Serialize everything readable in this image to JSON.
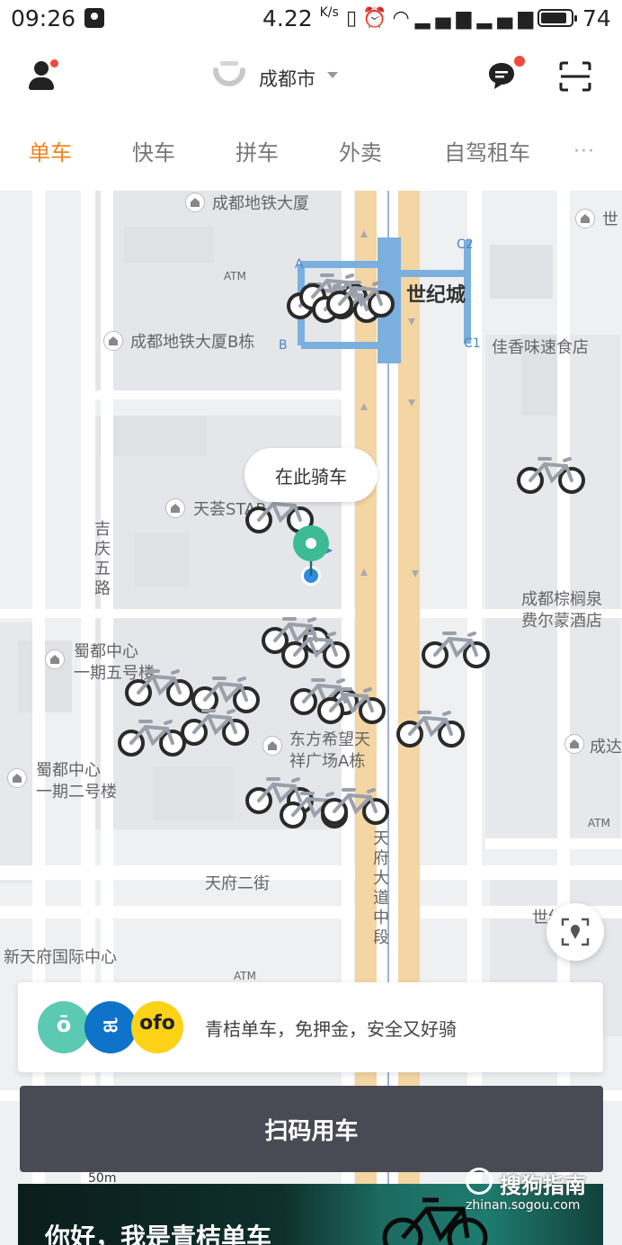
{
  "status_bar": {
    "time": "09:26",
    "speed": "4.22",
    "speed_unit": "K/s",
    "battery_level": "74",
    "network": "3G"
  },
  "header": {
    "city": "成都市",
    "has_user_notification": true,
    "has_message_notification": true
  },
  "tabs": [
    {
      "label": "单车",
      "active": true
    },
    {
      "label": "快车",
      "active": false
    },
    {
      "label": "拼车",
      "active": false
    },
    {
      "label": "外卖",
      "active": false
    },
    {
      "label": "自驾租车",
      "active": false
    }
  ],
  "tabs_more": "···",
  "map": {
    "labels": {
      "metro_building": "成都地铁大厦",
      "metro_building_b": "成都地铁大厦B栋",
      "shijicheng": "世纪城",
      "shi_partial": "世",
      "jiaxiang": "佳香味速食店",
      "tianhui": "天荟STAR",
      "jiqing_road": "吉庆五路",
      "palm_hotel_1": "成都棕榈泉",
      "palm_hotel_2": "费尔蒙酒店",
      "shudu_5_1": "蜀都中心",
      "shudu_5_2": "一期五号楼",
      "dongfang_1": "东方希望天",
      "dongfang_2": "祥广场A栋",
      "shudu_2_1": "蜀都中心",
      "shudu_2_2": "一期二号楼",
      "cheng_partial": "成达",
      "tianfu_avenue": "天府大道中段",
      "tianfu_2nd_st": "天府二街",
      "xin_tianfu": "新天府国际中心",
      "shiji_partial": "世纪",
      "exit_a": "A",
      "exit_b": "B",
      "exit_c1": "C1",
      "exit_c2": "C2",
      "atm_1": "ATM",
      "atm_2": "ATM",
      "atm_3": "ATM"
    },
    "ride_here_bubble": "在此骑车"
  },
  "banner": {
    "logos": [
      {
        "name": "qingju",
        "text": "ō",
        "color": "#5cc9b2"
      },
      {
        "name": "mobike",
        "text": "ಹ",
        "color": "#0f73c9"
      },
      {
        "name": "ofo",
        "text": "ofo",
        "color": "#fcd217"
      }
    ],
    "text": "青桔单车，免押金，安全又好骑"
  },
  "scan_button": "扫码用车",
  "promo": {
    "text": "你好，我是青桔单车",
    "scale": "50m"
  },
  "watermark": {
    "main": "搜狗指南",
    "sub": "zhinan.sogou.com"
  },
  "colors": {
    "accent": "#f5821f",
    "button_bg": "#4a4a55",
    "pin": "#3dbb93",
    "metro": "#6aaae0"
  }
}
